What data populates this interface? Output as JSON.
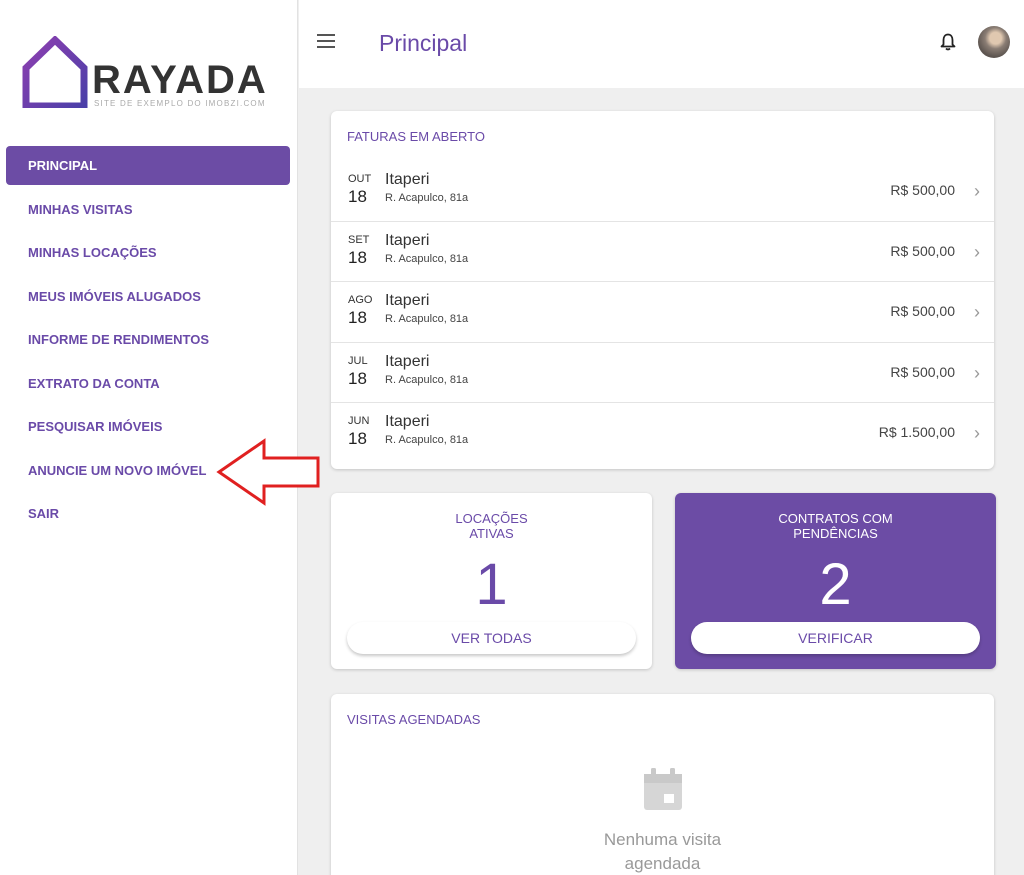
{
  "brand": {
    "name": "RAYADA",
    "tagline": "SITE DE EXEMPLO DO IMOBZI.COM",
    "accent": "#6c4ca5"
  },
  "sidebar": {
    "items": [
      {
        "label": "PRINCIPAL",
        "active": true
      },
      {
        "label": "MINHAS VISITAS"
      },
      {
        "label": "MINHAS LOCAÇÕES"
      },
      {
        "label": "MEUS IMÓVEIS ALUGADOS"
      },
      {
        "label": "INFORME DE RENDIMENTOS"
      },
      {
        "label": "EXTRATO DA CONTA"
      },
      {
        "label": "PESQUISAR IMÓVEIS"
      },
      {
        "label": "ANUNCIE UM NOVO IMÓVEL"
      },
      {
        "label": "SAIR"
      }
    ]
  },
  "header": {
    "title": "Principal",
    "icons": [
      "menu-icon",
      "bell-icon",
      "avatar"
    ]
  },
  "invoices": {
    "title": "FATURAS EM ABERTO",
    "rows": [
      {
        "month": "OUT",
        "day": "18",
        "name": "Itaperi",
        "address": "R. Acapulco, 81a",
        "value": "R$ 500,00"
      },
      {
        "month": "SET",
        "day": "18",
        "name": "Itaperi",
        "address": "R. Acapulco, 81a",
        "value": "R$ 500,00"
      },
      {
        "month": "AGO",
        "day": "18",
        "name": "Itaperi",
        "address": "R. Acapulco, 81a",
        "value": "R$ 500,00"
      },
      {
        "month": "JUL",
        "day": "18",
        "name": "Itaperi",
        "address": "R. Acapulco, 81a",
        "value": "R$ 500,00"
      },
      {
        "month": "JUN",
        "day": "18",
        "name": "Itaperi",
        "address": "R. Acapulco, 81a",
        "value": "R$ 1.500,00"
      }
    ]
  },
  "stats": {
    "active": {
      "label_line1": "LOCAÇÕES",
      "label_line2": "ATIVAS",
      "value": "1",
      "button": "VER TODAS"
    },
    "pending": {
      "label_line1": "CONTRATOS COM",
      "label_line2": "PENDÊNCIAS",
      "value": "2",
      "button": "VERIFICAR"
    }
  },
  "visits": {
    "title": "VISITAS AGENDADAS",
    "empty_line1": "Nenhuma visita",
    "empty_line2": "agendada"
  },
  "annotation": {
    "color": "#e02020",
    "icon": "red-arrow-icon"
  }
}
